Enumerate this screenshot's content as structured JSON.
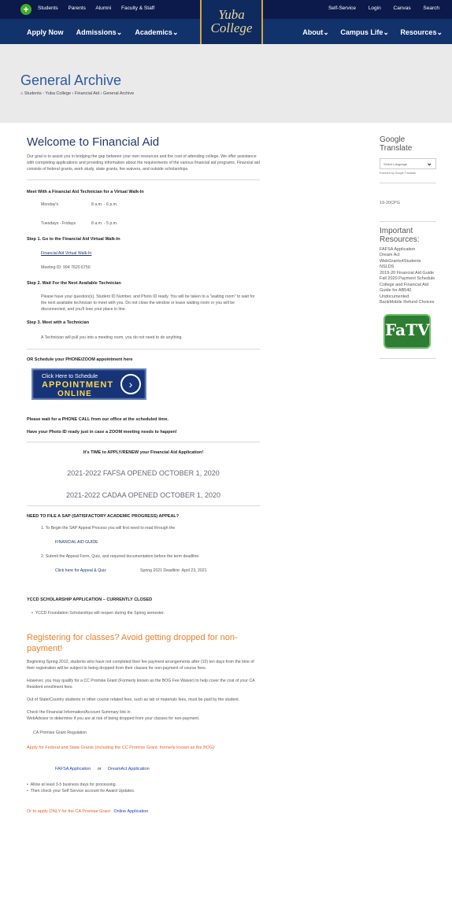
{
  "topbar": {
    "links_left": [
      "Students",
      "Parents",
      "Alumni",
      "Faculty & Staff"
    ],
    "links_right": [
      "Self-Service",
      "Login",
      "Canvas",
      "Search"
    ]
  },
  "nav": {
    "left": [
      "Apply Now",
      "Admissions",
      "Academics"
    ],
    "right": [
      "About",
      "Campus Life",
      "Resources"
    ],
    "logo_line1": "Yuba",
    "logo_line2": "College"
  },
  "header": {
    "title": "General Archive",
    "breadcrumb": "Students - Yuba College  ›  Financial Aid  ›  General Archive"
  },
  "main": {
    "heading": "Welcome to Financial Aid",
    "intro": "Our goal is to assist you in bridging the gap between your own resources and the cost of attending college. We offer assistance with completing applications and providing information about the requirements of the various financial aid programs. Financial aid consists of federal grants, work study, state grants, fee waivers, and outside scholarships.",
    "meet_heading": "Meet With a Financial Aid Technician for a Virtual Walk-In",
    "hours": [
      {
        "days": "Monday's",
        "time": "8 a.m. - 6 p.m."
      },
      {
        "days": "Tuesdays - Fridays",
        "time": "8 a.m. - 5 p.m."
      }
    ],
    "step1": "Step 1. Go to the Financial Aid Virtual Walk-In",
    "step1_link": "Financial Aid Virtual Walk-In",
    "meeting_id": "Meeting ID:  994 7620 6750",
    "step2": "Step 2. Wait For the Next Available Technician",
    "step2_text": "Please have your question(s), Student ID Number, and Photo ID ready.  You will be taken to a \"waiting room\" to wait for the next available technician to meet with you. Do not close the window or leave waiting room or you will be disconnected, and you'll lose your place in line.",
    "step3": "Step 3. Meet with a Technician",
    "step3_text": "A Technician will pull you into a meeting room, you do not need to do anything.",
    "schedule": "OR Schedule your PHONE/ZOOM appointment here",
    "btn_line1": "Click Here to Schedule",
    "btn_line2": "APPOINTMENT",
    "btn_line3": "ONLINE",
    "wait_call": "Please wait for a PHONE CALL from our office at the scheduled time.",
    "photo_id": "Have your Photo ID ready just in case a ZOOM meeting needs to happen!",
    "time_to_apply": "It's TIME to APPLY/RENEW your Financial Aid Application!",
    "fafsa_opened": "2021-2022 FAFSA OPENED OCTOBER 1, 2020",
    "cadaa_opened": "2021-2022 CADAA OPENED OCTOBER 1, 2020",
    "sap_heading": "NEED TO FILE A SAP (SATISFACTORY ACADEMIC PROGRESS) APPEAL?",
    "sap_item1": "1. To Begin the SAP Appeal Process you will first need to read through the",
    "sap_guide": "FINANCIAL AID GUIDE",
    "sap_item2": "2. Submit the Appeal Form, Quiz, and required documentation before the term deadline.",
    "sap_click": "Click here for Appeal & Quiz",
    "sap_deadline": "Spring 2021 Deadline: April 23, 2021",
    "yccd_heading": "YCCD SCHOLARSHIP APPLICATION – CURRENTLY CLOSED",
    "yccd_text": "YCCD Foundation Scholarships will reopen during the Spring semester.",
    "register_heading": "Registering for classes?  Avoid getting dropped for non-payment!",
    "reg_p1": "Beginning Spring 2012, students who have not completed their fee payment arrangements after (10) ten days from the time of their registration will be subject to being dropped from their classes for non-payment of course fees.",
    "reg_p2": "However, you may qualify for a CC Promise Grant (Formerly known as the BOG Fee Waiver) to help cover the cost of your CA Resident enrollment fees.",
    "reg_p3": "Out of State/Country students or other course related fees, such as lab or materials fees, must be paid by the student.",
    "reg_p4a": "Check the Financial Information/Account Summary link in",
    "reg_p4b": "WebAdvisor to determine if you are at risk of being dropped from your classes for non-payment.",
    "ca_promise_reg": "CA Promise Grant Regulation",
    "apply_federal": "Apply for Federal and State Grants (including the CC Promise Grant, formerly known as the BOG):",
    "fafsa_app": "FAFSA Application",
    "or": "or",
    "dream_app": "DreamAct Application",
    "allow": "Allow at least 3-5 business days for processing.",
    "then_check": "Then check your Self Service account for Award Updates.",
    "or_apply": "Or to apply ONLY for the CA Promise Grant",
    "online_app": "Online Application"
  },
  "sidebar": {
    "translate_heading": "Google Translate",
    "select_value": "Select Language",
    "powered": "Powered by Google Translate",
    "code": "19-20CPG",
    "resources_heading": "Important Resources:",
    "resources": [
      "FAFSA Application",
      "Dream Act",
      "WebGrants4Students",
      "NSLDS",
      "2019-20 Financial Aid Guide",
      "Fall 2020 Payment Schedule",
      "College and Financial Aid Guide for AB540 Undocumented",
      "BankMobile Refund Choices"
    ],
    "ktv_label": "FaTV"
  },
  "colors": {
    "nav_dark": "#0b1a4a",
    "nav_main": "#12326b",
    "title_blue": "#2d5aa0",
    "orange": "#e8802c",
    "gold": "#d4a73a"
  }
}
